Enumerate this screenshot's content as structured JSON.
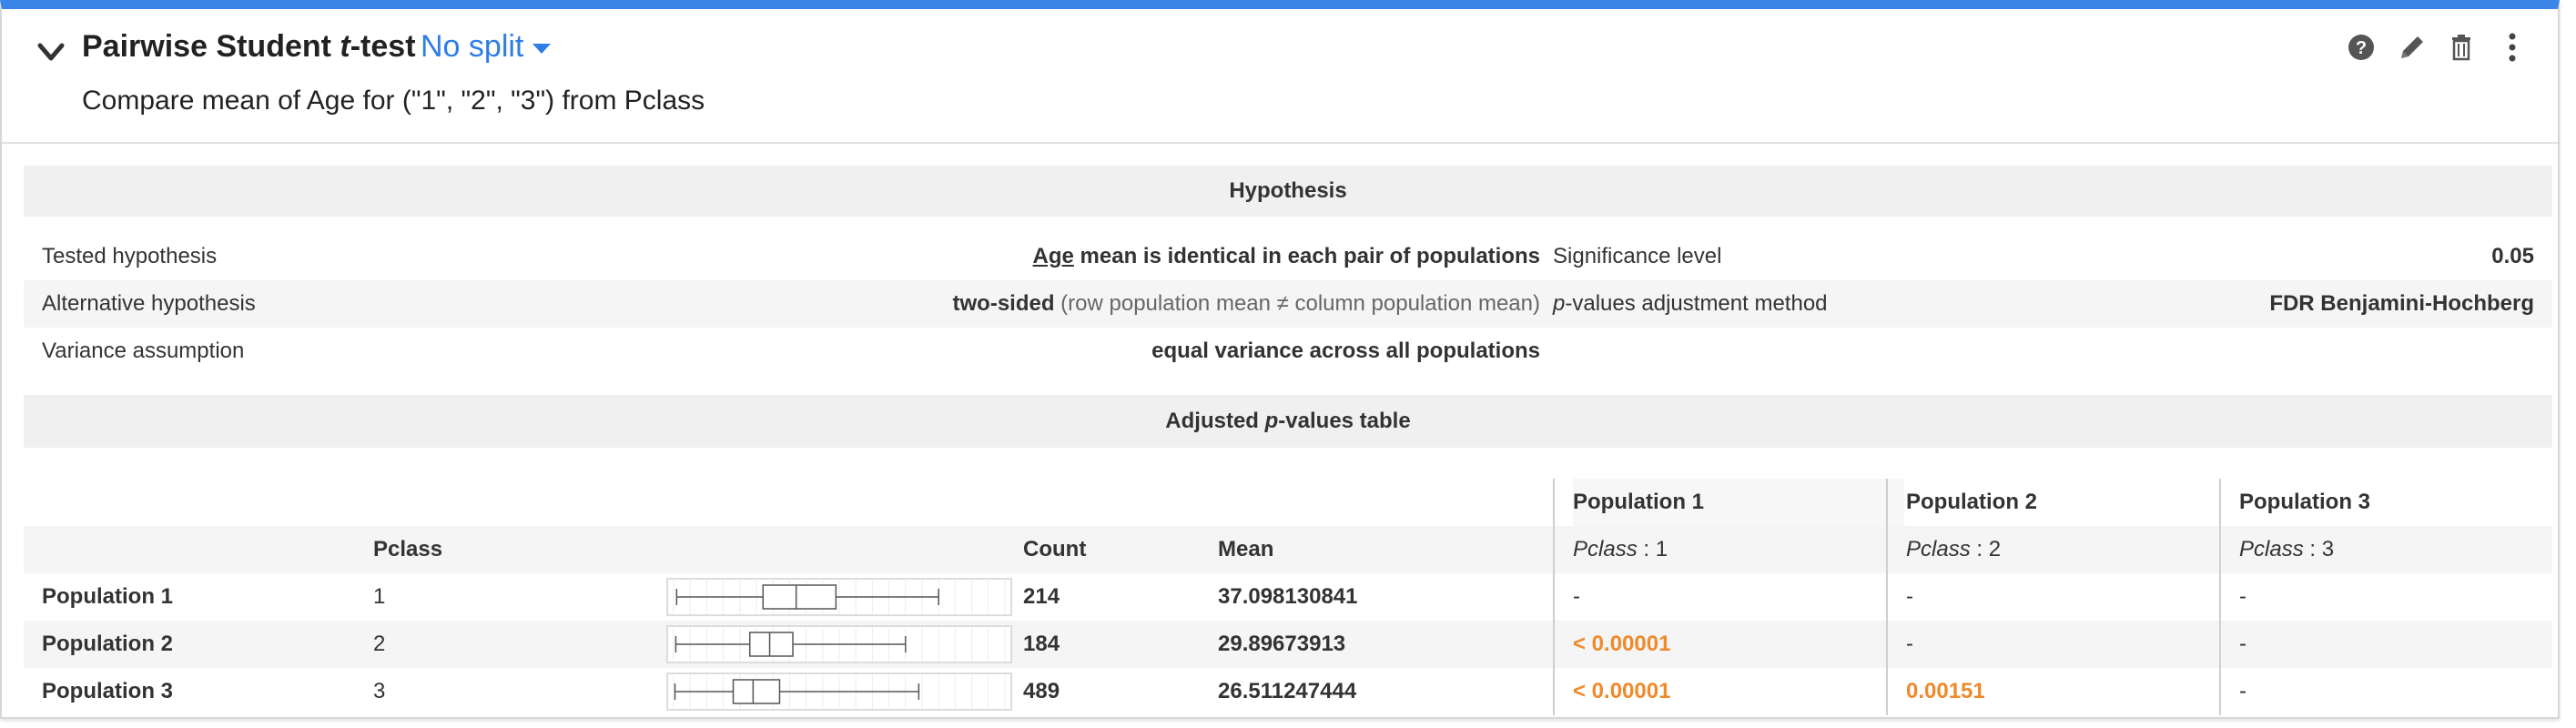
{
  "header": {
    "title_prefix": "Pairwise Student ",
    "title_italic": "t",
    "title_suffix": "-test",
    "split_label": "No split",
    "subtitle": "Compare mean of Age for (\"1\", \"2\", \"3\") from Pclass",
    "icons": [
      "help-icon",
      "pencil-icon",
      "trash-icon",
      "more-vertical-icon"
    ]
  },
  "hypothesis": {
    "section_title": "Hypothesis",
    "tested_label": "Tested hypothesis",
    "tested_value_var": "Age",
    "tested_value_rest": " mean is identical in each pair of populations",
    "alternative_label": "Alternative hypothesis",
    "alternative_value": "two-sided",
    "alternative_detail": " (row population mean ≠ column population mean)",
    "variance_label": "Variance assumption",
    "variance_value": "equal variance across all populations",
    "significance_label": "Significance level",
    "significance_value": "0.05",
    "adjust_label_italic": "p",
    "adjust_label_rest": "-values adjustment method",
    "adjust_value": "FDR Benjamini-Hochberg"
  },
  "pvalues": {
    "section_title_prefix": "Adjusted ",
    "section_title_italic": "p",
    "section_title_suffix": "-values table",
    "columns": {
      "pclass": "Pclass",
      "count": "Count",
      "mean": "Mean"
    },
    "col_populations": [
      {
        "title": "Population 1",
        "sub_var": "Pclass",
        "sub_val": " : 1"
      },
      {
        "title": "Population 2",
        "sub_var": "Pclass",
        "sub_val": " : 2"
      },
      {
        "title": "Population 3",
        "sub_var": "Pclass",
        "sub_val": " : 3"
      }
    ],
    "rows": [
      {
        "name": "Population 1",
        "pclass": "1",
        "count": "214",
        "mean": "37.098130841",
        "p": [
          "-",
          "-",
          "-"
        ]
      },
      {
        "name": "Population 2",
        "pclass": "2",
        "count": "184",
        "mean": "29.89673913",
        "p": [
          "< 0.00001",
          "-",
          "-"
        ]
      },
      {
        "name": "Population 3",
        "pclass": "3",
        "count": "489",
        "mean": "26.511247444",
        "p": [
          "< 0.00001",
          "0.00151",
          "-"
        ]
      }
    ],
    "boxplots": [
      {
        "min": 0.92,
        "q1": 27,
        "median": 37,
        "q3": 49,
        "max": 80
      },
      {
        "min": 0.67,
        "q1": 23,
        "median": 29,
        "q3": 36,
        "max": 70
      },
      {
        "min": 0.42,
        "q1": 18,
        "median": 24,
        "q3": 32,
        "max": 74
      }
    ],
    "boxplot_range": [
      0,
      100
    ]
  },
  "colors": {
    "accent": "#3a86e8",
    "link": "#2e7ee6",
    "highlight": "#ef8a2b"
  }
}
